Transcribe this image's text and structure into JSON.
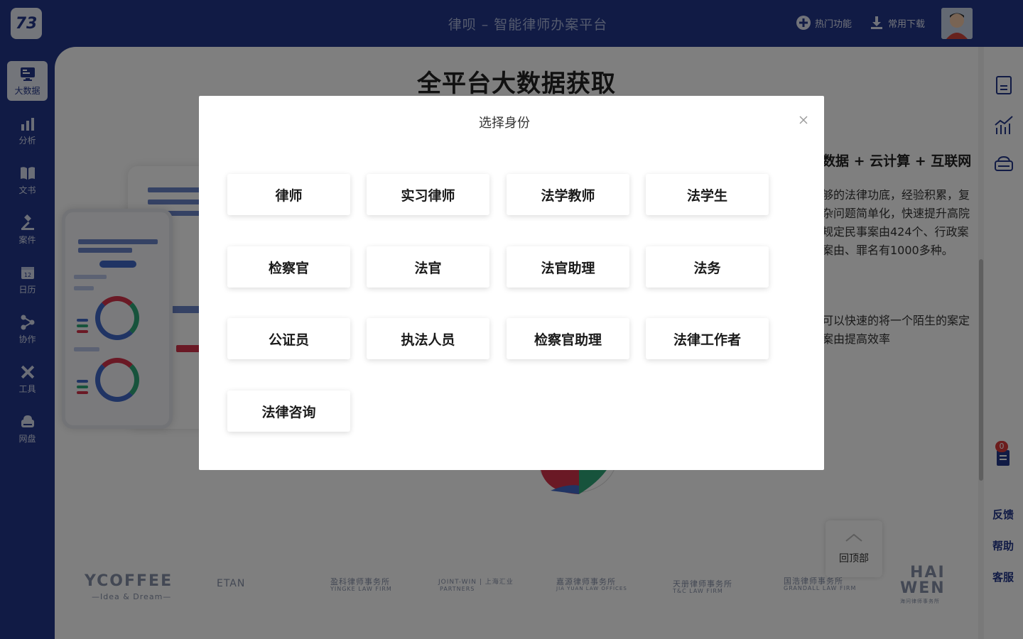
{
  "app": {
    "logo_text": "73",
    "title": "律呗 – 智能律师办案平台"
  },
  "header": {
    "hot_features": "热门功能",
    "downloads": "常用下载"
  },
  "sidebar": {
    "items": [
      {
        "label": "大数据",
        "icon": "monitor-icon"
      },
      {
        "label": "分析",
        "icon": "chart-icon"
      },
      {
        "label": "文书",
        "icon": "book-icon"
      },
      {
        "label": "案件",
        "icon": "gavel-icon"
      },
      {
        "label": "日历",
        "icon": "calendar-icon"
      },
      {
        "label": "协作",
        "icon": "collaboration-icon"
      },
      {
        "label": "工具",
        "icon": "tools-icon"
      },
      {
        "label": "网盘",
        "icon": "cloud-drive-icon"
      }
    ]
  },
  "calendar_day": "12",
  "main": {
    "title": "全平台大数据获取",
    "feature_heading": "数据 + 云计算 + 互联网",
    "feature_desc": "够的法律功底，经验积累，复杂问题简单化，快速提升高院规定民事案由424个、行政案案由、罪名有1000多种。",
    "feature_desc2": "可以快速的将一个陌生的案定案由提高效率",
    "partners": [
      "YCOFFEE",
      "—Idea & Dream—",
      "ETAN",
      "盈科律师事务所",
      "YINGKE LAW FIRM",
      "JOINT-WIN | 上海汇业",
      "PARTNERS",
      "嘉源律师事务所",
      "JIA YUAN LAW OFFICES",
      "天册律师事务所",
      "T&C LAW FIRM",
      "国浩律师事务所",
      "GRANDALL LAW FIRM",
      "HAI",
      "WEN",
      "海问律师事务所"
    ]
  },
  "right_rail": {
    "badge_count": "0",
    "feedback": "反馈",
    "help": "帮助",
    "service": "客服"
  },
  "back_to_top": "回顶部",
  "modal": {
    "title": "选择身份",
    "roles": [
      "律师",
      "实习律师",
      "法学教师",
      "法学生",
      "检察官",
      "法官",
      "法官助理",
      "法务",
      "公证员",
      "执法人员",
      "检察官助理",
      "法律工作者",
      "法律咨询"
    ]
  },
  "colors": {
    "brand": "#22368a",
    "overlay": "rgba(0,0,0,0.5)",
    "badge": "#d93a3a"
  }
}
